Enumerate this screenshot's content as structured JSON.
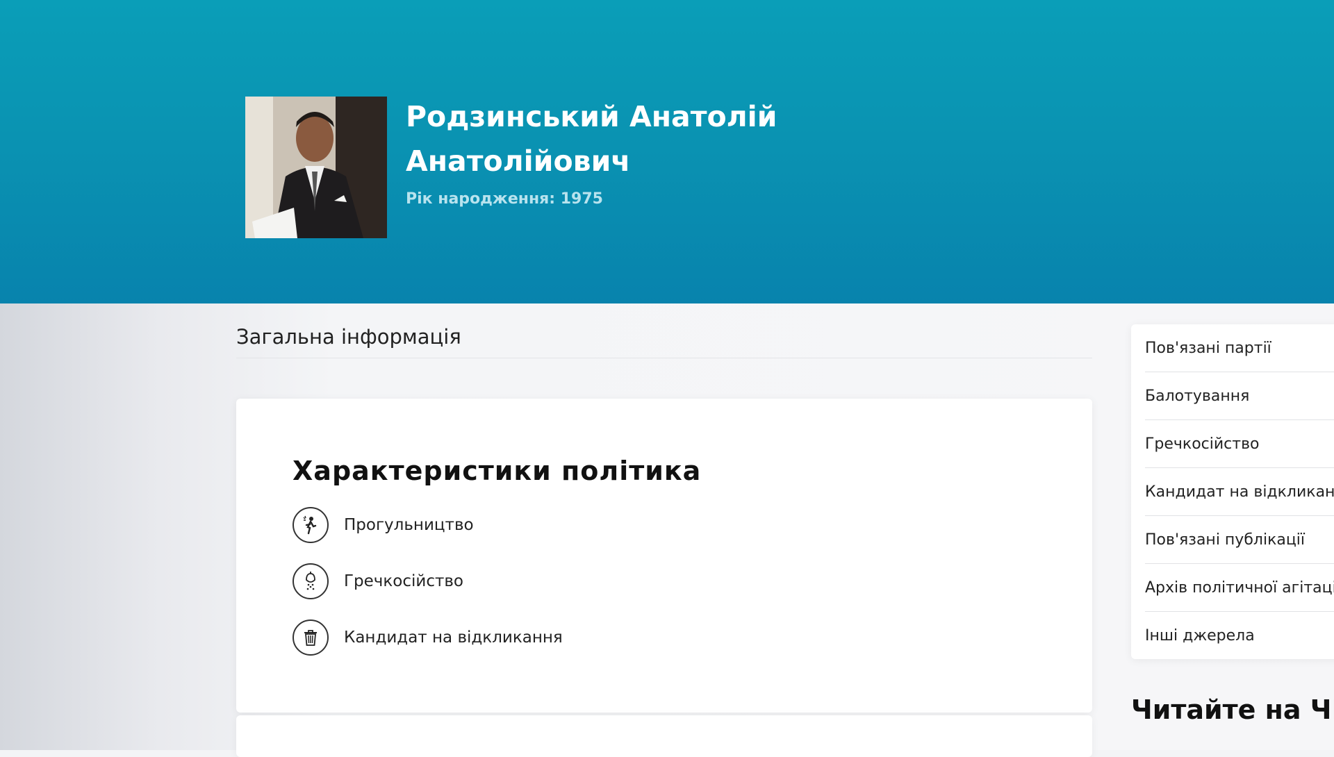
{
  "profile": {
    "name_line1": "Родзинський Анатолій",
    "name_line2": "Анатолійович",
    "birth_year": "Рік народження: 1975"
  },
  "section": {
    "title": "Загальна інформація"
  },
  "characteristics": {
    "title": "Характеристики політика",
    "items": [
      {
        "label": "Прогульництво",
        "icon": "truant-runner-icon"
      },
      {
        "label": "Гречкосійство",
        "icon": "buckwheat-icon"
      },
      {
        "label": "Кандидат на відкликання",
        "icon": "trash-icon"
      }
    ]
  },
  "sidebar": {
    "items": [
      {
        "label": "Пов'язані партії"
      },
      {
        "label": "Балотування"
      },
      {
        "label": "Гречкосійство"
      },
      {
        "label": "Кандидат на відкликанн"
      },
      {
        "label": "Пов'язані публікації"
      },
      {
        "label": "Архів політичної агітаці"
      },
      {
        "label": "Інші джерела"
      }
    ]
  },
  "read_more": {
    "title": "Читайте на ЧЕС"
  },
  "colors": {
    "header": "#0a93b2",
    "text": "#222222",
    "card": "#ffffff"
  }
}
